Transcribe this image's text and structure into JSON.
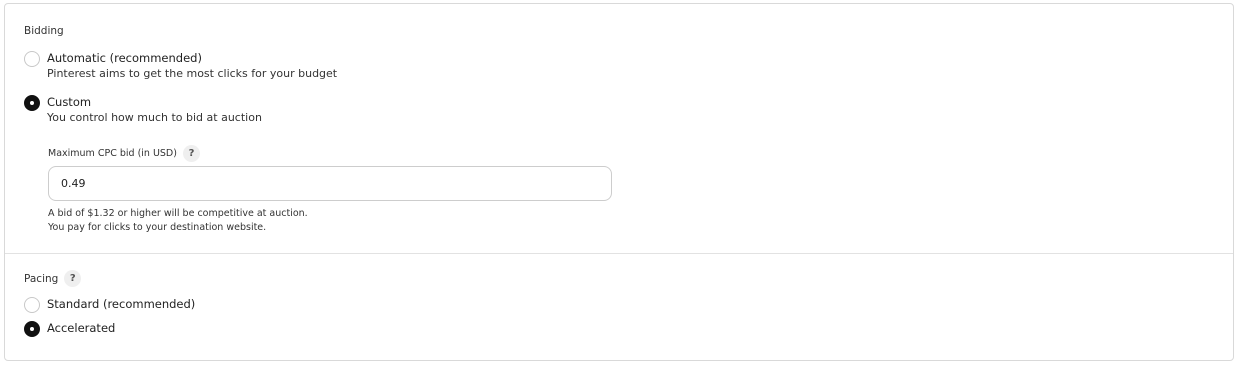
{
  "bidding": {
    "title": "Bidding",
    "options": [
      {
        "label": "Automatic (recommended)",
        "description": "Pinterest aims to get the most clicks for your budget",
        "selected": false
      },
      {
        "label": "Custom",
        "description": "You control how much to bid at auction",
        "selected": true
      }
    ],
    "max_cpc": {
      "label": "Maximum CPC bid (in USD)",
      "help": "?",
      "value": "0.49"
    },
    "hint_lines": [
      "A bid of $1.32 or higher will be competitive at auction.",
      "You pay for clicks to your destination website."
    ]
  },
  "pacing": {
    "title": "Pacing",
    "help": "?",
    "options": [
      {
        "label": "Standard (recommended)",
        "selected": false
      },
      {
        "label": "Accelerated",
        "selected": true
      }
    ]
  }
}
